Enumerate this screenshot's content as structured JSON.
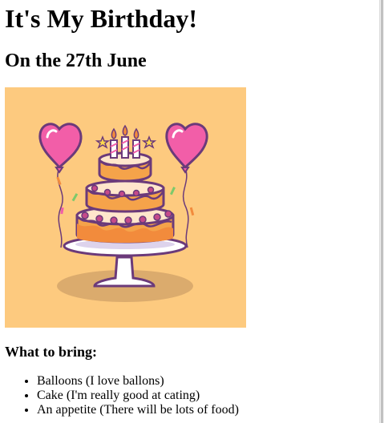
{
  "heading": "It's My Birthday!",
  "subheading": "On the 27th June",
  "image": {
    "icon": "birthday-cake-illustration",
    "background": "#fdca7f"
  },
  "bring_heading": "What to bring:",
  "bring_items": [
    "Balloons (I love ballons)",
    "Cake (I'm really good at cating)",
    "An appetite (There will be lots of food)"
  ]
}
